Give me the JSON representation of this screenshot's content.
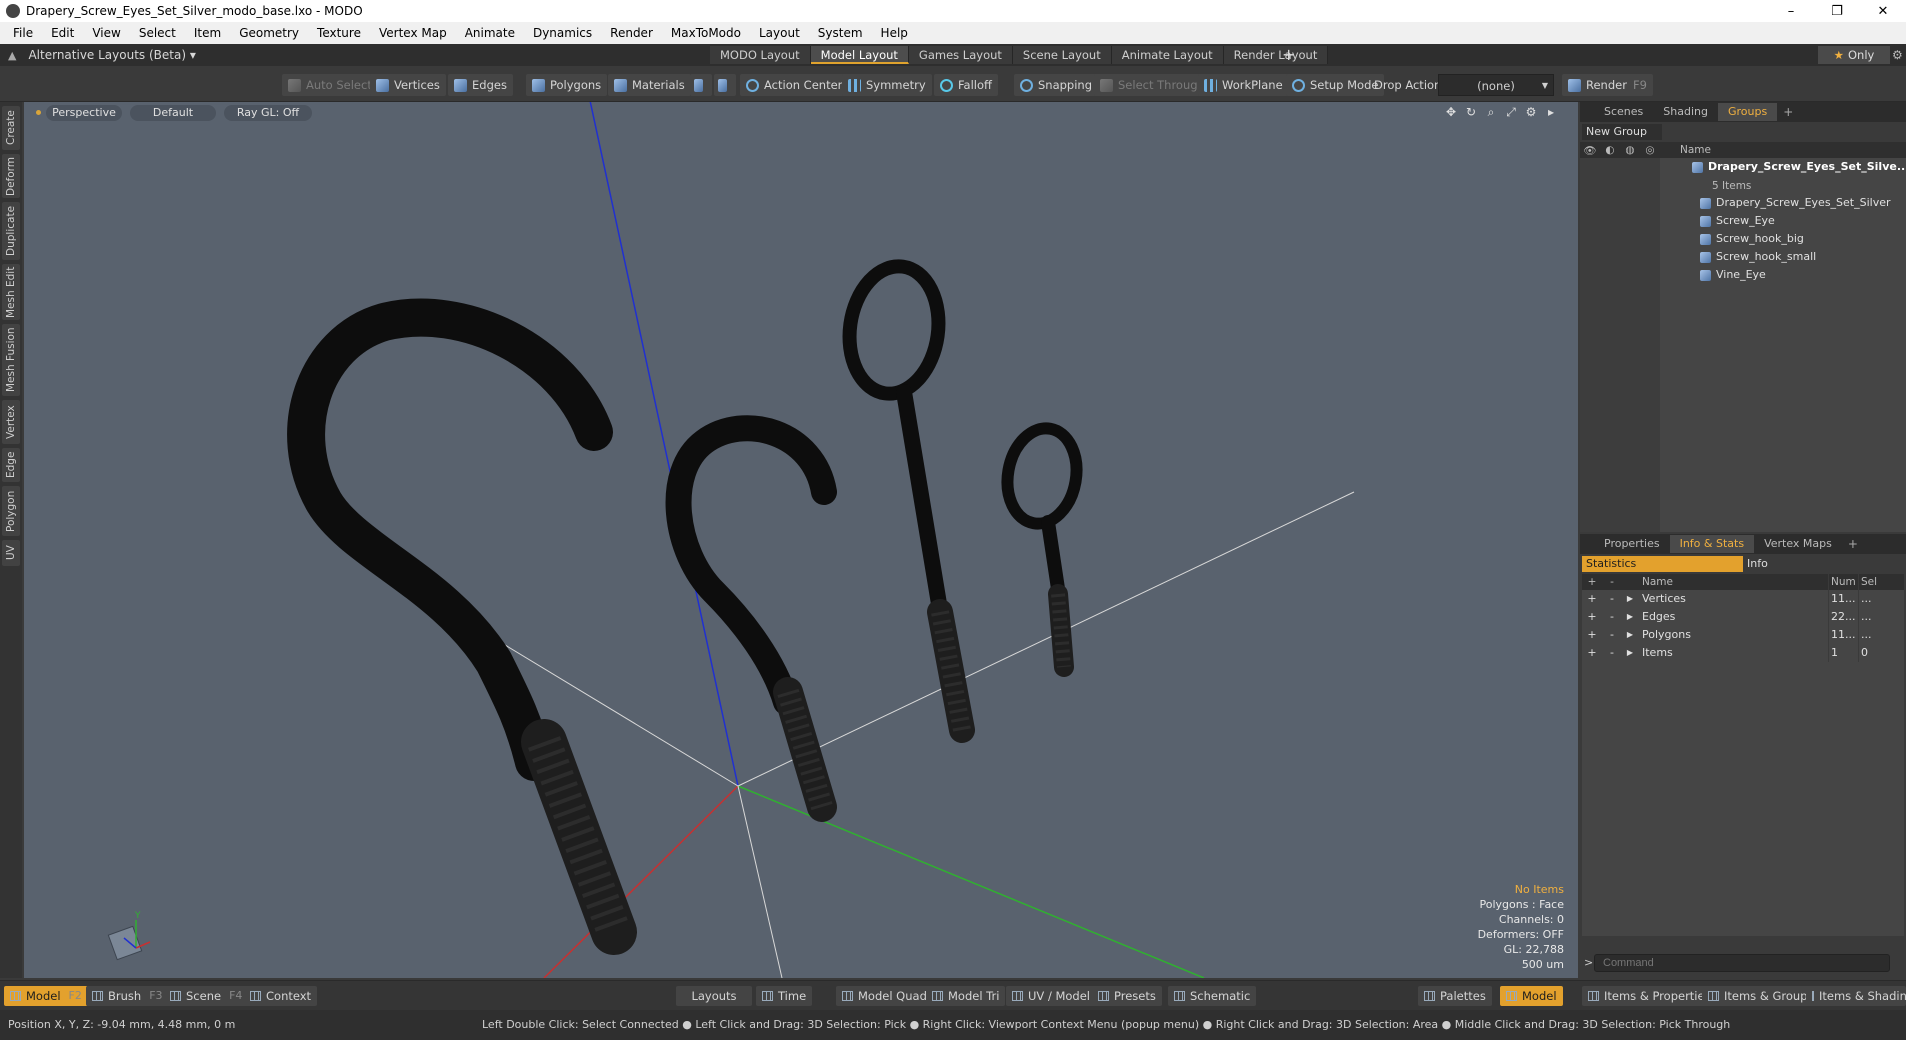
{
  "window": {
    "title": "Drapery_Screw_Eyes_Set_Silver_modo_base.lxo - MODO",
    "minimize": "–",
    "restore": "❐",
    "close": "✕"
  },
  "menu": [
    "File",
    "Edit",
    "View",
    "Select",
    "Item",
    "Geometry",
    "Texture",
    "Vertex Map",
    "Animate",
    "Dynamics",
    "Render",
    "MaxToModo",
    "Layout",
    "System",
    "Help"
  ],
  "layoutbar": {
    "alt_layouts": "Alternative Layouts (Beta) ▾",
    "tabs": [
      "MODO Layout",
      "Model Layout",
      "Games Layout",
      "Scene Layout",
      "Animate Layout",
      "Render Layout"
    ],
    "active_tab": "Model Layout",
    "add": "+",
    "only": "Only"
  },
  "toolbar": {
    "auto_select": "Auto Select",
    "vertices": "Vertices",
    "edges": "Edges",
    "polygons": "Polygons",
    "materials": "Materials",
    "action_center": "Action Center",
    "symmetry": "Symmetry",
    "falloff": "Falloff",
    "snapping": "Snapping",
    "select_through": "Select Through",
    "workplane": "WorkPlane",
    "setup_mode": "Setup Mode",
    "drop_action": "Drop Action",
    "drop_value": "(none)",
    "render": "Render",
    "render_key": "F9"
  },
  "left_tabs": [
    "Create",
    "Deform",
    "Duplicate",
    "Mesh Edit",
    "Mesh Fusion",
    "Vertex",
    "Edge",
    "Polygon",
    "UV"
  ],
  "viewport": {
    "view": "Perspective",
    "shading": "Default",
    "raygl": "Ray GL: Off",
    "info": {
      "items": "No Items",
      "polygons": "Polygons : Face",
      "channels": "Channels: 0",
      "deformers": "Deformers: OFF",
      "gl": "GL: 22,788",
      "scale": "500 um"
    }
  },
  "groups_panel": {
    "tabs": [
      "Scenes",
      "Shading",
      "Groups"
    ],
    "active_tab": "Groups",
    "new_group": "New Group",
    "name_col": "Name",
    "root": "Drapery_Screw_Eyes_Set_Silve...",
    "root_sub": "5 Items",
    "items": [
      "Drapery_Screw_Eyes_Set_Silver",
      "Screw_Eye",
      "Screw_hook_big",
      "Screw_hook_small",
      "Vine_Eye"
    ]
  },
  "stats_panel": {
    "tabs": [
      "Properties",
      "Info & Stats",
      "Vertex Maps"
    ],
    "active_tab": "Info & Stats",
    "statistics": "Statistics",
    "info": "Info",
    "cols": {
      "name": "Name",
      "num": "Num",
      "sel": "Sel"
    },
    "rows": [
      {
        "name": "Vertices",
        "num": "11...",
        "sel": "..."
      },
      {
        "name": "Edges",
        "num": "22...",
        "sel": "..."
      },
      {
        "name": "Polygons",
        "num": "11...",
        "sel": "..."
      },
      {
        "name": "Items",
        "num": "1",
        "sel": "0"
      }
    ],
    "command_placeholder": "Command"
  },
  "modebar": {
    "model": "Model",
    "model_key": "F2",
    "brush": "Brush",
    "brush_key": "F3",
    "scene": "Scene",
    "scene_key": "F4",
    "context": "Context",
    "layouts": "Layouts",
    "time": "Time",
    "model_quad": "Model Quad",
    "model_tri": "Model Tri",
    "uv_model": "UV / Model",
    "presets": "Presets",
    "schematic": "Schematic",
    "palettes": "Palettes",
    "model_right": "Model",
    "items_props": "Items & Properties",
    "items_groups": "Items & Groups",
    "items_shading": "Items & Shading"
  },
  "status": {
    "position": "Position X, Y, Z:   -9.04 mm, 4.48 mm, 0 m",
    "hint": "Left Double Click: Select Connected ● Left Click and Drag: 3D Selection: Pick ● Right Click: Viewport Context Menu (popup menu) ● Right Click and Drag: 3D Selection: Area ● Middle Click and Drag: 3D Selection: Pick Through"
  },
  "colors": {
    "accent": "#e3a12d",
    "viewport_bg": "#59626e",
    "axis_x": "#d03030",
    "axis_y": "#30b030",
    "axis_z": "#2030d0"
  }
}
